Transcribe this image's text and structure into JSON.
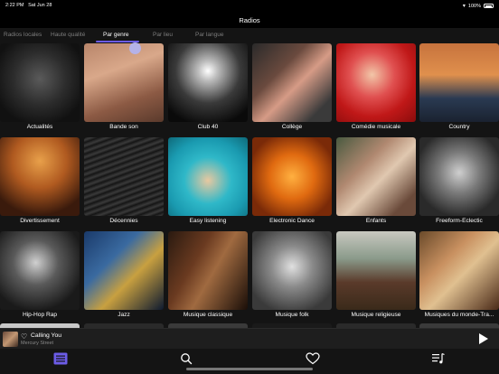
{
  "status_bar": {
    "time": "2:22 PM",
    "date": "Sat Jun 28",
    "battery": "100%"
  },
  "header": {
    "title": "Radios"
  },
  "tabs": [
    {
      "label": "Radios locales"
    },
    {
      "label": "Haute qualité"
    },
    {
      "label": "Par genre"
    },
    {
      "label": "Par lieu"
    },
    {
      "label": "Par langue"
    }
  ],
  "genres": [
    {
      "label": "Actualités"
    },
    {
      "label": "Bande son"
    },
    {
      "label": "Club 40"
    },
    {
      "label": "Collège"
    },
    {
      "label": "Comédie musicale"
    },
    {
      "label": "Country"
    },
    {
      "label": "Divertissement"
    },
    {
      "label": "Décennies"
    },
    {
      "label": "Easy listening"
    },
    {
      "label": "Electronic Dance"
    },
    {
      "label": "Enfants"
    },
    {
      "label": "Freeform-Eclectic"
    },
    {
      "label": "Hip-Hop Rap"
    },
    {
      "label": "Jazz"
    },
    {
      "label": "Musique classique"
    },
    {
      "label": "Musique folk"
    },
    {
      "label": "Musique religieuse"
    },
    {
      "label": "Musiques du monde-Tra..."
    }
  ],
  "mini_player": {
    "title": "Calling You",
    "subtitle": "Mercury Street"
  },
  "tab_bar": {
    "items": [
      {
        "icon": "library-icon"
      },
      {
        "icon": "search-icon"
      },
      {
        "icon": "heart-icon"
      },
      {
        "icon": "queue-icon"
      }
    ]
  },
  "colors": {
    "accent": "#6c5ce7",
    "background": "#141414"
  }
}
